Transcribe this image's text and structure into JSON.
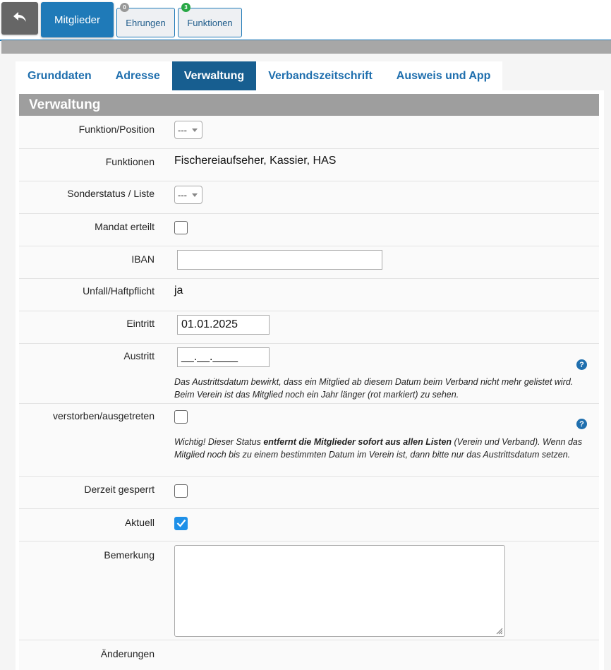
{
  "top_tabs": {
    "members": "Mitglieder",
    "honors": "Ehrungen",
    "honors_badge": "0",
    "functions": "Funktionen",
    "functions_badge": "3"
  },
  "sub_tabs": [
    "Grunddaten",
    "Adresse",
    "Verwaltung",
    "Verbandszeitschrift",
    "Ausweis und App"
  ],
  "section_title": "Verwaltung",
  "fields": {
    "funktion_position": {
      "label": "Funktion/Position",
      "value": "---"
    },
    "funktionen": {
      "label": "Funktionen",
      "value": "Fischereiaufseher, Kassier, HAS"
    },
    "sonderstatus": {
      "label": "Sonderstatus / Liste",
      "value": "---"
    },
    "mandat": {
      "label": "Mandat erteilt",
      "checked": false
    },
    "iban": {
      "label": "IBAN",
      "value": ""
    },
    "unfall": {
      "label": "Unfall/Haftpflicht",
      "value": "ja"
    },
    "eintritt": {
      "label": "Eintritt",
      "value": "01.01.2025"
    },
    "austritt": {
      "label": "Austritt",
      "value": "__.__.____",
      "note": "Das Austrittsdatum bewirkt, dass ein Mitglied ab diesem Datum beim Verband nicht mehr gelistet wird. Beim Verein ist das Mitglied noch ein Jahr länger (rot markiert) zu sehen."
    },
    "verstorben": {
      "label": "verstorben/ausgetreten",
      "checked": false,
      "note_pre": "Wichtig! Dieser Status ",
      "note_bold": "entfernt die Mitglieder sofort aus allen Listen",
      "note_post": " (Verein und Verband). Wenn das Mitglied noch bis zu einem bestimmten Datum im Verein ist, dann bitte nur das Austrittsdatum setzen."
    },
    "gesperrt": {
      "label": "Derzeit gesperrt",
      "checked": false
    },
    "aktuell": {
      "label": "Aktuell",
      "checked": true
    },
    "bemerkung": {
      "label": "Bemerkung",
      "value": ""
    },
    "aenderungen": {
      "label": "Änderungen"
    }
  },
  "help_icon_text": "?",
  "colors": {
    "primary": "#1f7ab8",
    "active_tab": "#175e90",
    "header_gray": "#9e9e9e",
    "checkbox_blue": "#1e90e8"
  }
}
